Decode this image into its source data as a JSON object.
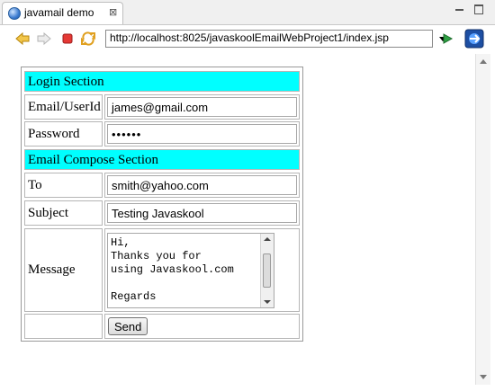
{
  "tab": {
    "title": "javamail demo",
    "close_glyph": "⊠"
  },
  "toolbar": {
    "url": "http://localhost:8025/javaskoolEmailWebProject1/index.jsp",
    "icons": [
      "back-arrow-icon",
      "forward-arrow-icon",
      "stop-icon",
      "refresh-icon",
      "go-icon",
      "external-browser-icon"
    ]
  },
  "form": {
    "login_section": "Login Section",
    "email_label": "Email/UserId",
    "email_value": "james@gmail.com",
    "password_label": "Password",
    "password_value": "••••••",
    "compose_section": "Email Compose Section",
    "to_label": "To",
    "to_value": "smith@yahoo.com",
    "subject_label": "Subject",
    "subject_value": "Testing Javaskool",
    "message_label": "Message",
    "message_value": "Hi,\nThanks you for\nusing Javaskool.com\n\nRegards",
    "send_label": "Send"
  },
  "colors": {
    "section_bg": "#00ffff",
    "go_green": "#2ea043",
    "stop_red": "#e53935"
  }
}
